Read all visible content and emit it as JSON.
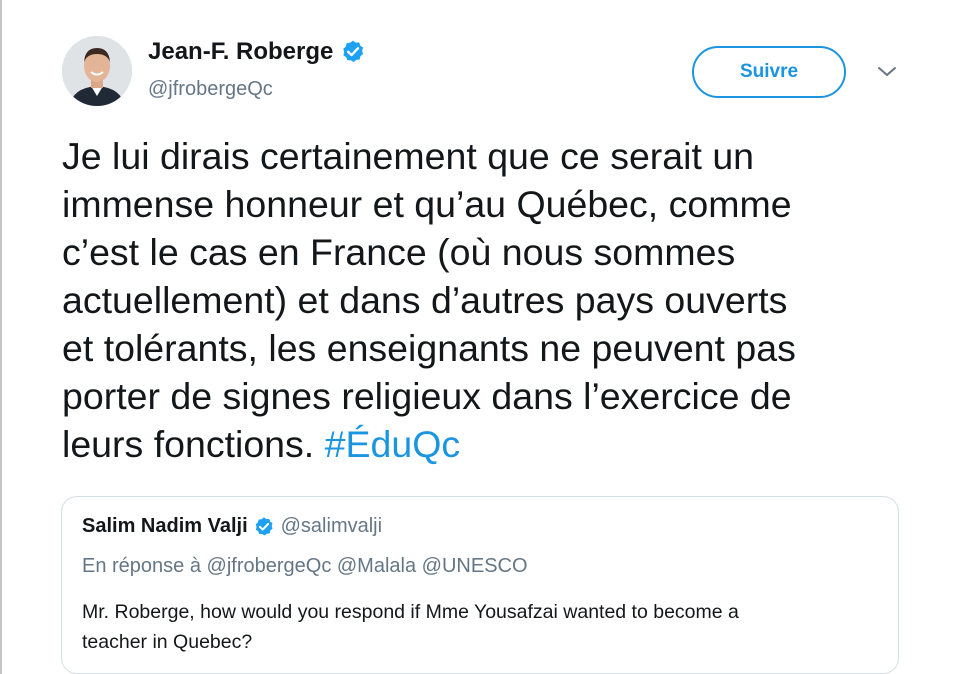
{
  "tweet": {
    "author": {
      "name": "Jean-F. Roberge",
      "handle": "@jfrobergeQc",
      "verified_icon": "verified-badge-icon",
      "avatar_icon": "profile-photo-avatar"
    },
    "follow_label": "Suivre",
    "menu_icon": "chevron-down-icon",
    "text_lines": [
      "Je lui dirais certainement que ce serait un",
      "immense honneur et qu’au Québec, comme",
      "c’est le cas en France (où nous sommes",
      "actuellement) et dans d’autres pays ouverts",
      "et tolérants, les enseignants ne peuvent pas",
      "porter de signes religieux dans l’exercice de",
      "leurs fonctions."
    ],
    "hashtag": "#ÉduQc"
  },
  "quote": {
    "author_name": "Salim Nadim Valji",
    "author_handle": "@salimvalji",
    "reply_to": "En réponse à @jfrobergeQc @Malala @UNESCO",
    "text_lines": [
      "Mr. Roberge, how would you respond if Mme Yousafzai wanted to become a",
      "teacher in Quebec?"
    ]
  },
  "colors": {
    "accent": "#1b95e0",
    "text": "#14171a",
    "secondary": "#657786",
    "border": "#d6dfe5"
  }
}
